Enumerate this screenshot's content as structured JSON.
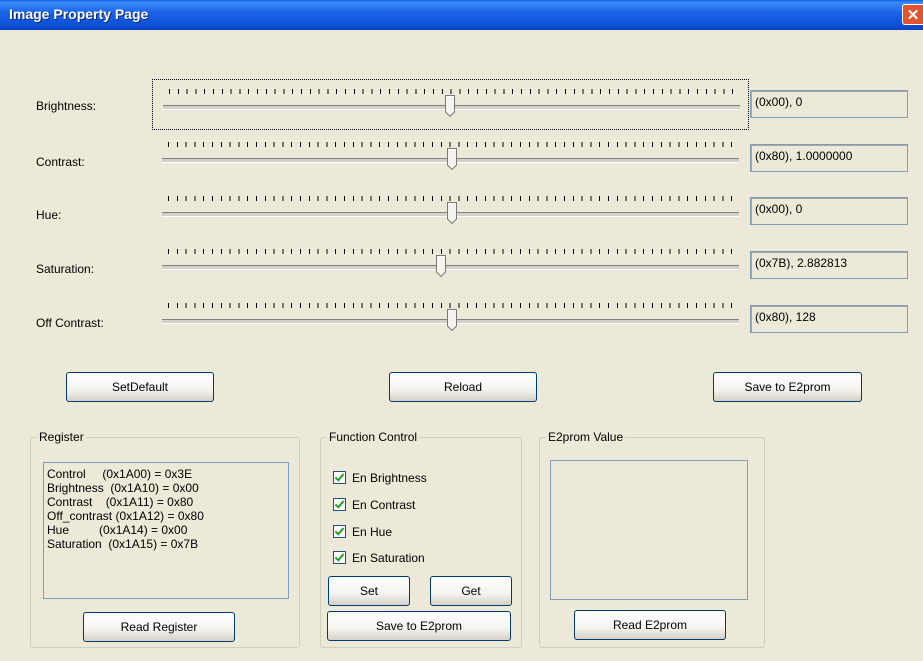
{
  "window": {
    "title": "Image Property Page",
    "close_glyph": "✕"
  },
  "sliders": [
    {
      "label": "Brightness:",
      "value_text": "(0x00),   0",
      "level": 0.5
    },
    {
      "label": "Contrast:",
      "value_text": "(0x80), 1.0000000",
      "level": 0.5
    },
    {
      "label": "Hue:",
      "value_text": "(0x00),   0",
      "level": 0.5
    },
    {
      "label": "Saturation:",
      "value_text": "(0x7B), 2.882813",
      "level": 0.48
    },
    {
      "label": "Off Contrast:",
      "value_text": "(0x80), 128",
      "level": 0.5
    }
  ],
  "buttons": {
    "set_default": "SetDefault",
    "reload": "Reload",
    "save_e2prom": "Save to E2prom"
  },
  "register": {
    "title": "Register",
    "lines": [
      "Control     (0x1A00) = 0x3E",
      "Brightness  (0x1A10) = 0x00",
      "Contrast    (0x1A11) = 0x80",
      "Off_contrast (0x1A12) = 0x80",
      "Hue         (0x1A14) = 0x00",
      "Saturation  (0x1A15) = 0x7B"
    ],
    "read_button": "Read Register"
  },
  "function_control": {
    "title": "Function Control",
    "checks": [
      {
        "label": "En Brightness",
        "checked": true
      },
      {
        "label": "En Contrast",
        "checked": true
      },
      {
        "label": "En Hue",
        "checked": true
      },
      {
        "label": "En Saturation",
        "checked": true
      }
    ],
    "set_button": "Set",
    "get_button": "Get",
    "save_button": "Save to E2prom"
  },
  "e2prom": {
    "title": "E2prom Value",
    "read_button": "Read E2prom"
  },
  "colors": {
    "titlebar": "#0c4fd6",
    "window_bg": "#ece9d8",
    "button_border": "#003c74",
    "close": "#e2542f",
    "check": "#21a121"
  }
}
